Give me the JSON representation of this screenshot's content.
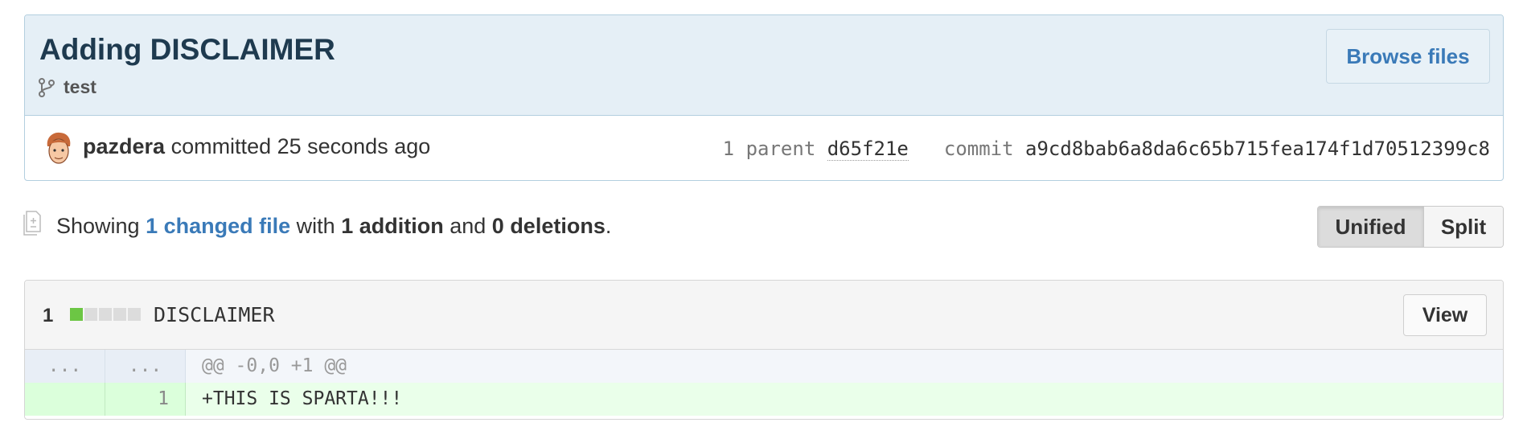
{
  "commit": {
    "title": "Adding DISCLAIMER",
    "branch": "test",
    "browse_label": "Browse files",
    "author": "pazdera",
    "action_text": "committed 25 seconds ago",
    "parent_label": "1 parent",
    "parent_sha": "d65f21e",
    "commit_label": "commit",
    "commit_sha": "a9cd8bab6a8da6c65b715fea174f1d70512399c8"
  },
  "toc": {
    "showing": "Showing",
    "changed_files": "1 changed file",
    "with": "with",
    "additions": "1 addition",
    "and": "and",
    "deletions": "0 deletions",
    "period": "."
  },
  "view_mode": {
    "unified_label": "Unified",
    "split_label": "Split",
    "selected": "Unified"
  },
  "file": {
    "count": "1",
    "name": "DISCLAIMER",
    "view_label": "View",
    "diffstat": [
      "add",
      "neutral",
      "neutral",
      "neutral",
      "neutral"
    ],
    "hunk": {
      "old_num": "...",
      "new_num": "...",
      "header": "@@ -0,0 +1 @@"
    },
    "lines": [
      {
        "old_num": "",
        "new_num": "1",
        "text": "+THIS IS SPARTA!!!"
      }
    ]
  },
  "colors": {
    "addition_green": "#6cc644",
    "link_blue": "#3a7ab8",
    "commit_header_bg": "#e5eff6"
  }
}
